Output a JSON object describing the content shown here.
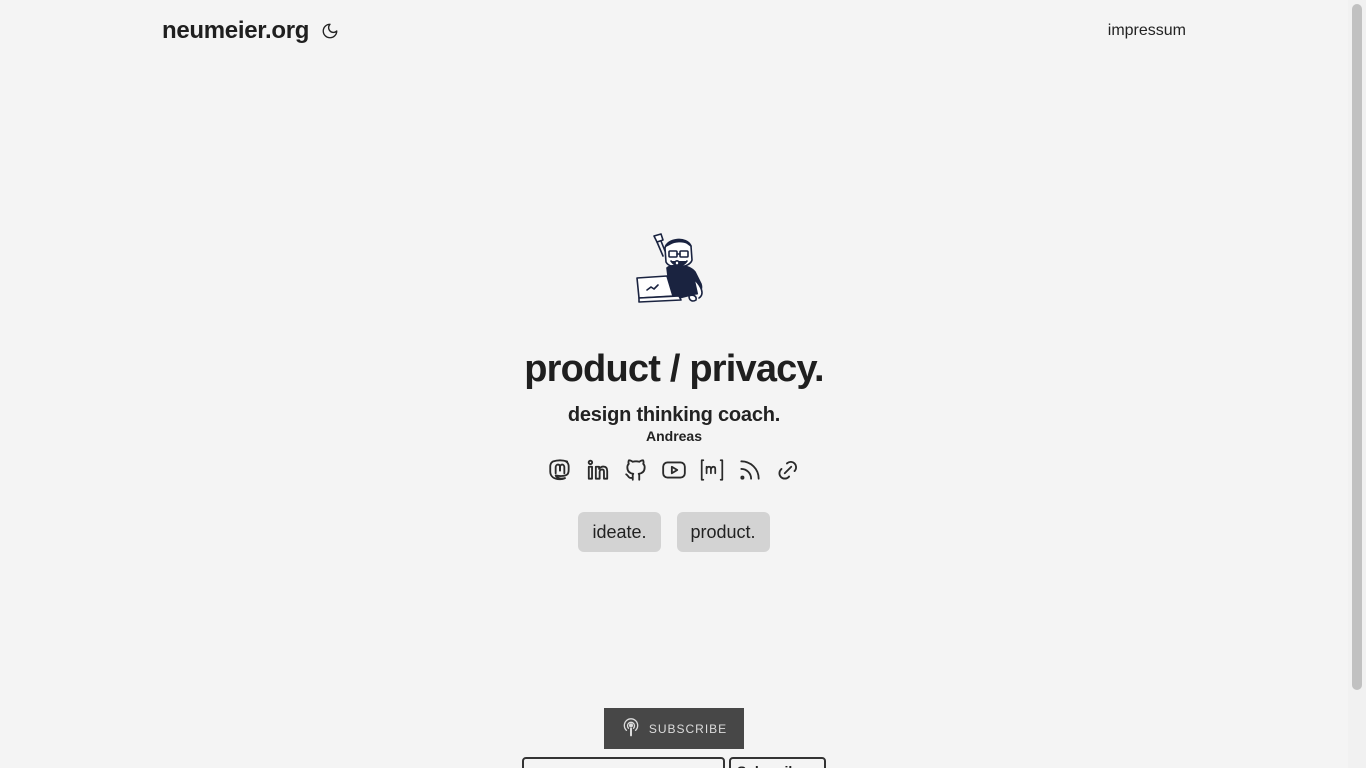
{
  "header": {
    "site_title": "neumeier.org",
    "theme_toggle_icon": "moon-icon",
    "nav_link": "impressum"
  },
  "hero": {
    "avatar_icon": "cartoon-avatar",
    "headline": "product / privacy.",
    "subheadline": "design thinking coach.",
    "author": "Andreas"
  },
  "social_icons": [
    "mastodon-icon",
    "linkedin-icon",
    "github-icon",
    "youtube-icon",
    "matrix-icon",
    "rss-icon",
    "link-icon"
  ],
  "buttons": [
    {
      "label": "ideate."
    },
    {
      "label": "product."
    }
  ],
  "subscribe": {
    "icon": "podcast-icon",
    "label": "SUBSCRIBE",
    "button_label": "Subscribe"
  },
  "colors": {
    "background": "#f4f4f4",
    "pill": "#d3d3d3",
    "subscribe_bg": "#474747"
  }
}
